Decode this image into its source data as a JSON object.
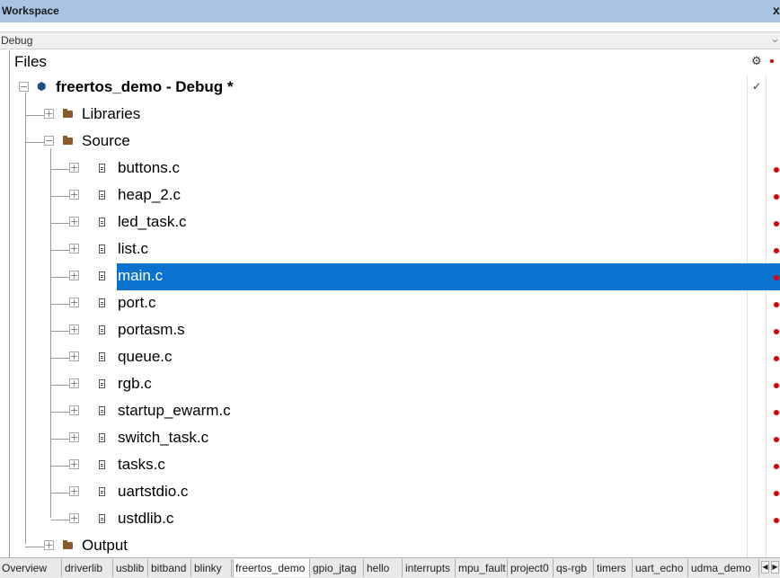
{
  "window": {
    "title": "Workspace",
    "close_glyph": "x"
  },
  "config": {
    "selected": "Debug"
  },
  "tree": {
    "header": "Files",
    "root": {
      "name": "freertos_demo",
      "suffix": " - Debug *"
    },
    "libraries": "Libraries",
    "source": "Source",
    "files": [
      "buttons.c",
      "heap_2.c",
      "led_task.c",
      "list.c",
      "main.c",
      "port.c",
      "portasm.s",
      "queue.c",
      "rgb.c",
      "startup_ewarm.c",
      "switch_task.c",
      "tasks.c",
      "uartstdio.c",
      "ustdlib.c"
    ],
    "selected_file": "main.c",
    "output": "Output"
  },
  "tabs": [
    "Overview",
    "driverlib",
    "usblib",
    "bitband",
    "blinky",
    "freertos_demo",
    "gpio_jtag",
    "hello",
    "interrupts",
    "mpu_fault",
    "project0",
    "qs-rgb",
    "timers",
    "uart_echo",
    "udma_demo"
  ],
  "active_tab": "freertos_demo",
  "colors": {
    "selection": "#0a72cf",
    "title_bar": "#a9c4e2",
    "status_dot": "#e00000"
  },
  "icons": {
    "settings": "gear-icon",
    "check": "check-icon",
    "file": "file-icon",
    "folder": "folder-icon",
    "project": "project-icon"
  }
}
